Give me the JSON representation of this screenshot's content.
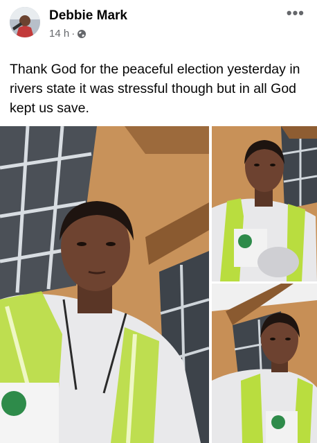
{
  "post": {
    "author": "Debbie Mark",
    "time": "14 h",
    "separator": "·",
    "privacy_icon": "globe-icon",
    "more_label": "•••",
    "text": "Thank God for the peaceful election yesterday in rivers state it was stressful though but in all God kept us save."
  },
  "photos": [
    {
      "name": "selfie-main",
      "description_icon": "photo"
    },
    {
      "name": "selfie-top-right",
      "description_icon": "photo"
    },
    {
      "name": "selfie-bottom-right",
      "description_icon": "photo"
    }
  ],
  "colors": {
    "name": "#050505",
    "meta": "#65676b",
    "vest": "#c9e84a",
    "wall": "#c98f52"
  }
}
